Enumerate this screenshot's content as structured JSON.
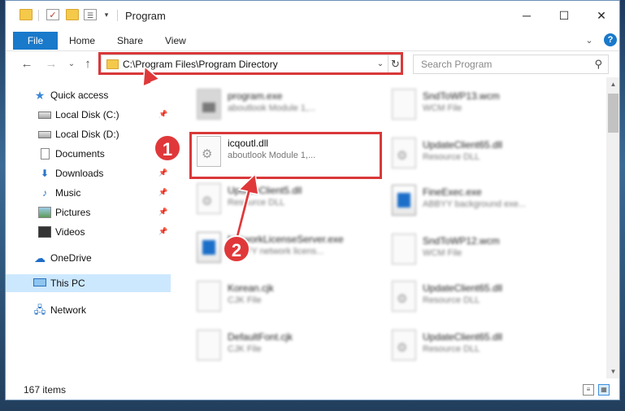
{
  "window": {
    "title": "Program",
    "minimize_glyph": "─",
    "maximize_glyph": "☐",
    "close_glyph": "✕"
  },
  "ribbon": {
    "file": "File",
    "home": "Home",
    "share": "Share",
    "view": "View",
    "expand_glyph": "⌄",
    "help_glyph": "?"
  },
  "nav": {
    "back_glyph": "←",
    "forward_glyph": "→",
    "recent_glyph": "⌄",
    "up_glyph": "↑",
    "address": "C:\\Program Files\\Program Directory",
    "address_dropdown_glyph": "⌄",
    "refresh_glyph": "↻",
    "search_placeholder": "Search Program",
    "search_glyph": "⚲"
  },
  "sidebar": {
    "items": [
      {
        "label": "Quick access",
        "icon": "star-icon"
      },
      {
        "label": "Local Disk (C:)",
        "icon": "drive-icon"
      },
      {
        "label": "Local Disk (D:)",
        "icon": "drive-icon"
      },
      {
        "label": "Documents",
        "icon": "document-icon"
      },
      {
        "label": "Downloads",
        "icon": "download-icon"
      },
      {
        "label": "Music",
        "icon": "music-icon"
      },
      {
        "label": "Pictures",
        "icon": "pictures-icon"
      },
      {
        "label": "Videos",
        "icon": "videos-icon"
      },
      {
        "label": "OneDrive",
        "icon": "cloud-icon"
      },
      {
        "label": "This PC",
        "icon": "computer-icon"
      },
      {
        "label": "Network",
        "icon": "network-icon"
      }
    ],
    "pin_glyph": "📌"
  },
  "files": {
    "left": [
      {
        "name": "program.exe",
        "desc": "aboutlook Module 1,..."
      },
      {
        "name": "icqoutl.dll",
        "desc": "aboutlook Module 1,..."
      },
      {
        "name": "UpdateClient5.dll",
        "desc": "Resource DLL"
      },
      {
        "name": "NetworkLicenseServer.exe",
        "desc": "ABBYY network licens..."
      },
      {
        "name": "Korean.cjk",
        "desc": "CJK File"
      },
      {
        "name": "DefaultFont.cjk",
        "desc": "CJK File"
      }
    ],
    "right": [
      {
        "name": "SndToWP13.wcm",
        "desc": "WCM File"
      },
      {
        "name": "UpdateClient65.dll",
        "desc": "Resource DLL"
      },
      {
        "name": "FineExec.exe",
        "desc": "ABBYY background exe..."
      },
      {
        "name": "SndToWP12.wcm",
        "desc": "WCM File"
      },
      {
        "name": "UpdateClient65.dll",
        "desc": "Resource DLL"
      },
      {
        "name": "UpdateClient65.dll",
        "desc": "Resource DLL"
      }
    ]
  },
  "status": {
    "item_count": "167 items"
  },
  "annotations": {
    "badge1": "1",
    "badge2": "2",
    "color": "#d9383a"
  }
}
